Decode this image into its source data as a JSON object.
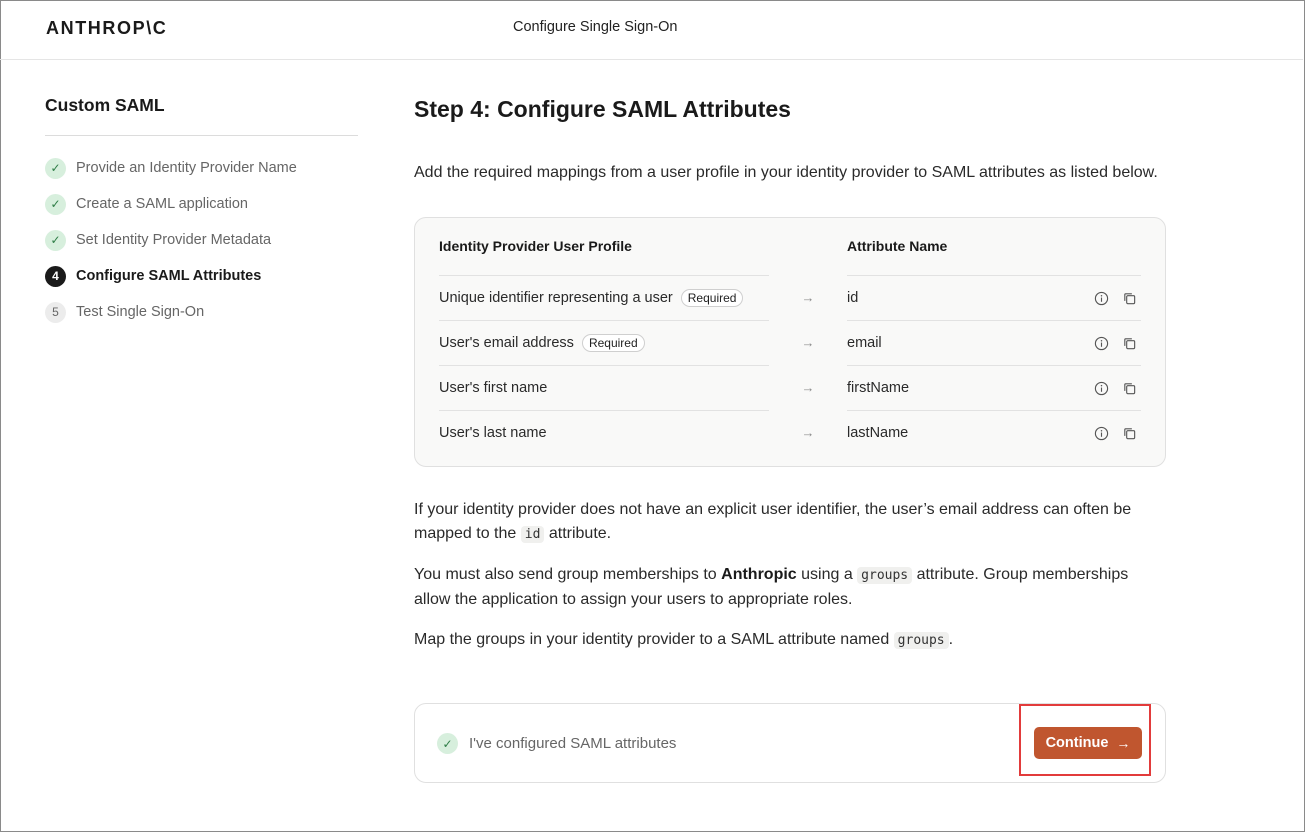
{
  "header": {
    "logo": "ANTHROP\\C",
    "title": "Configure Single Sign-On"
  },
  "sidebar": {
    "title": "Custom SAML",
    "steps": [
      {
        "label": "Provide an Identity Provider Name",
        "state": "done",
        "marker": "✓"
      },
      {
        "label": "Create a SAML application",
        "state": "done",
        "marker": "✓"
      },
      {
        "label": "Set Identity Provider Metadata",
        "state": "done",
        "marker": "✓"
      },
      {
        "label": "Configure SAML Attributes",
        "state": "current",
        "marker": "4"
      },
      {
        "label": "Test Single Sign-On",
        "state": "todo",
        "marker": "5"
      }
    ]
  },
  "main": {
    "title": "Step 4: Configure SAML Attributes",
    "intro": "Add the required mappings from a user profile in your identity provider to SAML attributes as listed below.",
    "mapping": {
      "col_profile": "Identity Provider User Profile",
      "col_attr": "Attribute Name",
      "required_label": "Required",
      "rows": [
        {
          "profile": "Unique identifier representing a user",
          "required": "Required",
          "attr": "id"
        },
        {
          "profile": "User's email address",
          "required": "Required",
          "attr": "email"
        },
        {
          "profile": "User's first name",
          "required": "",
          "attr": "firstName"
        },
        {
          "profile": "User's last name",
          "required": "",
          "attr": "lastName"
        }
      ]
    },
    "p1_a": "If your identity provider does not have an explicit user identifier, the user’s email address can often be mapped to the ",
    "p1_code": "id",
    "p1_b": " attribute.",
    "p2_a": "You must also send group memberships to ",
    "p2_bold": "Anthropic",
    "p2_b": " using a ",
    "p2_code": "groups",
    "p2_c": " attribute. Group memberships allow the application to assign your users to appropriate roles.",
    "p3_a": "Map the groups in your identity provider to a SAML attribute named ",
    "p3_code": "groups",
    "p3_b": "."
  },
  "confirm": {
    "label": "I've configured SAML attributes",
    "button": "Continue",
    "button_arrow": "→"
  },
  "colors": {
    "accent": "#c0562f",
    "success_bg": "#d7efdd",
    "highlight": "#e23b3b"
  },
  "icons": [
    "check-icon",
    "info-icon",
    "copy-icon",
    "arrow-right-icon"
  ]
}
